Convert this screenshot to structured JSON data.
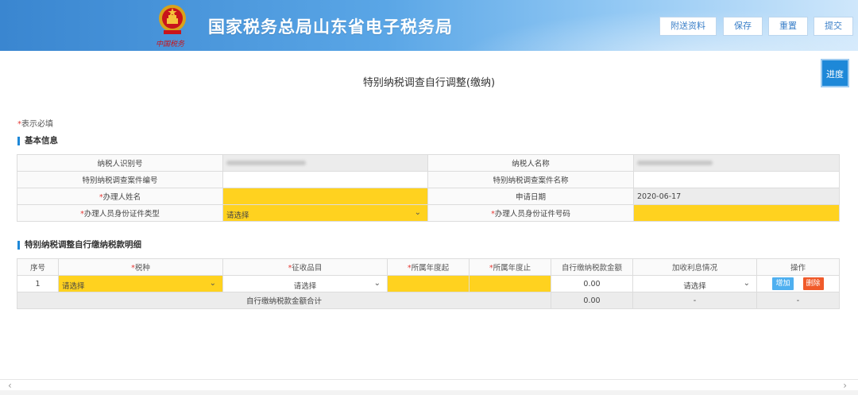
{
  "header": {
    "site_title": "国家税务总局山东省电子税务局",
    "emblem_caption": "中国税务",
    "buttons": {
      "attach": "附送资料",
      "save": "保存",
      "reset": "重置",
      "submit": "提交"
    }
  },
  "page": {
    "title": "特别纳税调查自行调整(缴纳)",
    "progress_label": "进度",
    "required_note": "表示必填",
    "required_mark": "*"
  },
  "basic_info": {
    "section_title": "基本信息",
    "rows": [
      {
        "label1": "纳税人识别号",
        "value1": "",
        "label2": "纳税人名称",
        "value2": ""
      },
      {
        "label1": "特别纳税调查案件编号",
        "value1": "",
        "label2": "特别纳税调查案件名称",
        "value2": ""
      },
      {
        "label1": "办理人姓名",
        "value1": "",
        "label2": "申请日期",
        "value2": "2020-06-17"
      },
      {
        "label1": "办理人员身份证件类型",
        "value1": "请选择",
        "label2": "办理人员身份证件号码",
        "value2": ""
      }
    ]
  },
  "detail": {
    "section_title": "特别纳税调整自行缴纳税款明细",
    "headers": {
      "seq": "序号",
      "tax_type": "税种",
      "item": "征收品目",
      "year_start": "所属年度起",
      "year_end": "所属年度止",
      "amount": "自行缴纳税款金额",
      "interest": "加收利息情况",
      "ops": "操作"
    },
    "row": {
      "seq": "1",
      "tax_type": "请选择",
      "item": "请选择",
      "amount": "0.00",
      "interest": "请选择",
      "add": "增加",
      "delete": "删除"
    },
    "sum": {
      "label": "自行缴纳税款金额合计",
      "amount": "0.00",
      "interest": "-",
      "ops": "-"
    }
  },
  "colors": {
    "header_blue": "#3a86d0",
    "accent": "#1e88d8",
    "required_yellow": "#ffd21f",
    "required_red": "#e53935",
    "add_blue": "#4fb0f0",
    "delete_orange": "#f05a2a"
  }
}
